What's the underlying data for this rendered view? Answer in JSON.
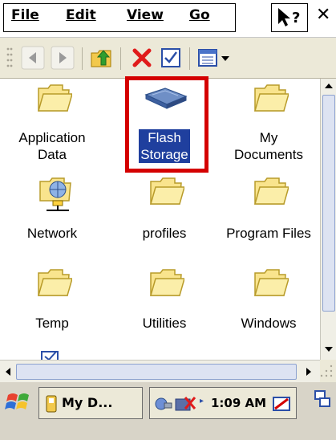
{
  "menu": {
    "file": "File",
    "edit": "Edit",
    "view": "View",
    "go": "Go",
    "help_icon": "help-icon",
    "close_label": "✕"
  },
  "toolbar": {
    "buttons": [
      "back-icon",
      "forward-icon",
      "up-folder-icon",
      "delete-icon",
      "properties-icon",
      "views-icon"
    ]
  },
  "items": [
    {
      "line1": "Application",
      "line2": "Data",
      "icon": "folder-icon"
    },
    {
      "line1": "Flash",
      "line2": "Storage",
      "icon": "storage-card-icon",
      "selected": true
    },
    {
      "line1": "My",
      "line2": "Documents",
      "icon": "folder-icon"
    },
    {
      "line1": "Network",
      "line2": "",
      "icon": "network-icon"
    },
    {
      "line1": "profiles",
      "line2": "",
      "icon": "folder-icon"
    },
    {
      "line1": "Program Files",
      "line2": "",
      "icon": "folder-icon"
    },
    {
      "line1": "Temp",
      "line2": "",
      "icon": "folder-icon"
    },
    {
      "line1": "Utilities",
      "line2": "",
      "icon": "folder-icon"
    },
    {
      "line1": "Windows",
      "line2": "",
      "icon": "folder-icon"
    }
  ],
  "taskbar": {
    "task_label": "My D...",
    "time": "1:09 AM"
  },
  "colors": {
    "selection": "#1f3f9e",
    "highlight_frame": "#d40000",
    "folder_fill": "#f9e48d",
    "toolbar_bg": "#ece9d8"
  }
}
